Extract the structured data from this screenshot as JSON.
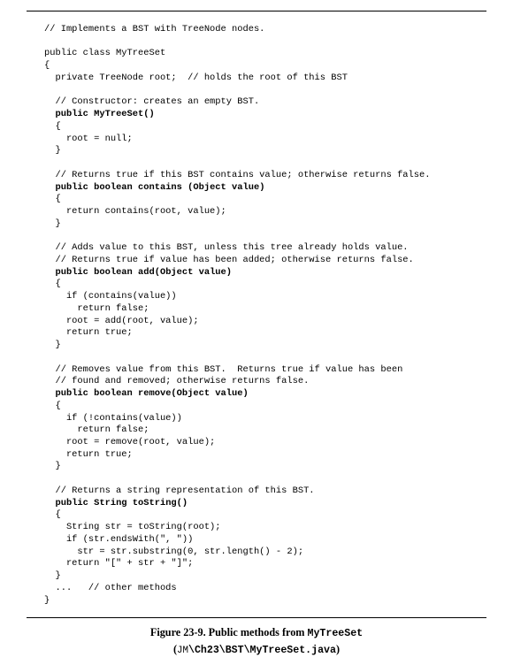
{
  "code": {
    "c1": "// Implements a BST with TreeNode nodes.",
    "c2": "public class MyTreeSet",
    "c3": "{",
    "c4": "  private TreeNode root;  // holds the root of this BST",
    "c5": "  // Constructor: creates an empty BST.",
    "c6a": "  ",
    "c6b": "public MyTreeSet()",
    "c7": "  {",
    "c8": "    root = null;",
    "c9": "  }",
    "c10": "  // Returns true if this BST contains value; otherwise returns false.",
    "c11a": "  ",
    "c11b": "public boolean contains (Object value)",
    "c12": "  {",
    "c13": "    return contains(root, value);",
    "c14": "  }",
    "c15": "  // Adds value to this BST, unless this tree already holds value.",
    "c16": "  // Returns true if value has been added; otherwise returns false.",
    "c17a": "  ",
    "c17b": "public boolean add(Object value)",
    "c18": "  {",
    "c19": "    if (contains(value))",
    "c20": "      return false;",
    "c21": "    root = add(root, value);",
    "c22": "    return true;",
    "c23": "  }",
    "c24": "  // Removes value from this BST.  Returns true if value has been",
    "c25": "  // found and removed; otherwise returns false.",
    "c26a": "  ",
    "c26b": "public boolean remove(Object value)",
    "c27": "  {",
    "c28": "    if (!contains(value))",
    "c29": "      return false;",
    "c30": "    root = remove(root, value);",
    "c31": "    return true;",
    "c32": "  }",
    "c33": "  // Returns a string representation of this BST.",
    "c34a": "  ",
    "c34b": "public String toString()",
    "c35": "  {",
    "c36": "    String str = toString(root);",
    "c37": "    if (str.endsWith(\", \"))",
    "c38": "      str = str.substring(0, str.length() - 2);",
    "c39": "    return \"[\" + str + \"]\";",
    "c40": "  }",
    "c41": "  ...   // other methods",
    "c42": "}"
  },
  "caption": {
    "fig": "Figure 23-9.   Public methods from ",
    "cls": "MyTreeSet",
    "open": "(",
    "jm": "JM",
    "path": "\\Ch23\\BST\\MyTreeSet.java",
    "close": ")"
  }
}
